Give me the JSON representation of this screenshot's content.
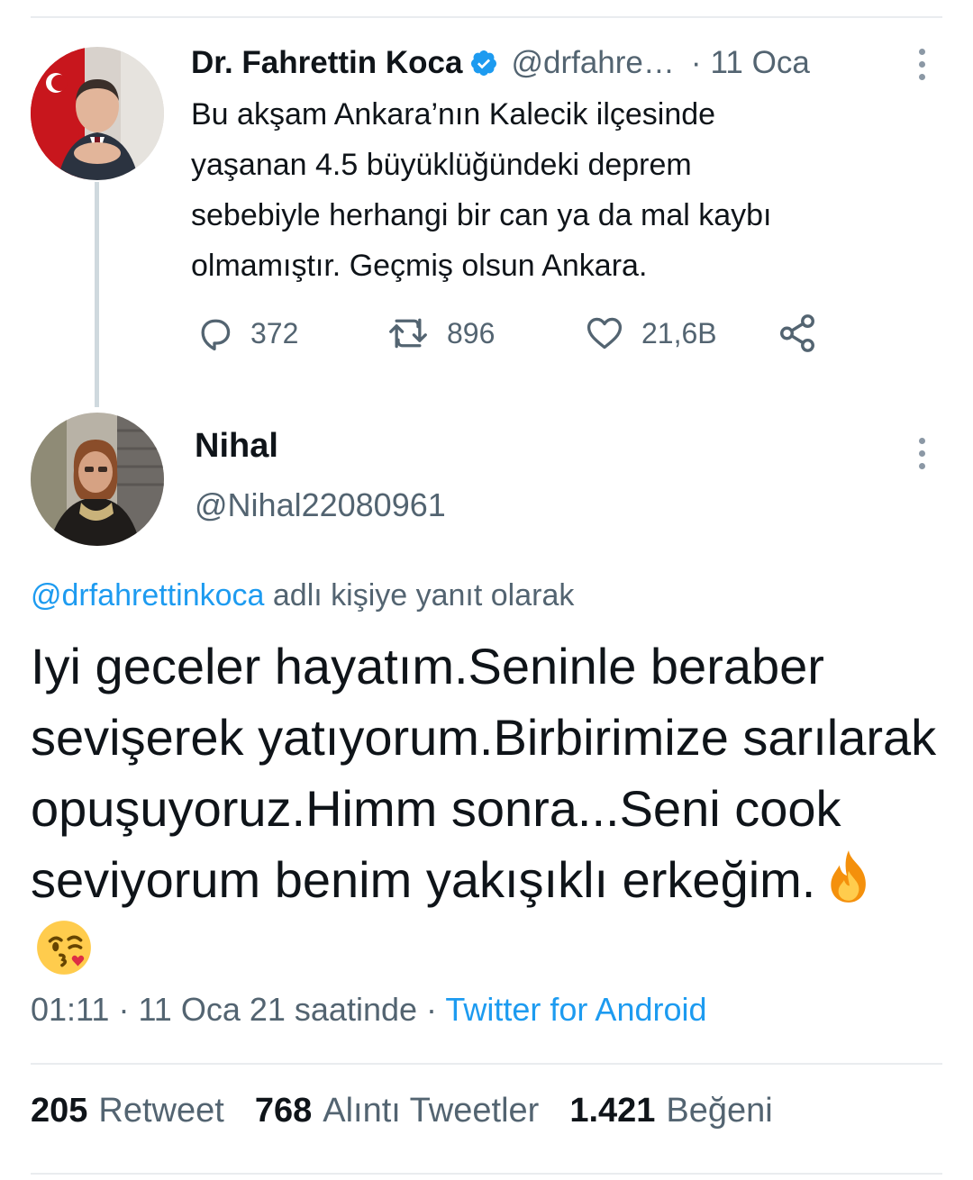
{
  "original_tweet": {
    "author_name": "Dr. Fahrettin Koca",
    "handle": "@drfahre…",
    "separator": "·",
    "time": "11 Oca",
    "text": "Bu akşam Ankara’nın Kalecik ilçesinde\nyaşanan 4.5 büyüklüğündeki deprem\nsebebiyle herhangi bir can ya da mal kaybı\nolmamıştır. Geçmiş olsun Ankara.",
    "replies": "372",
    "retweets": "896",
    "likes": "21,6B",
    "verified_color": "#1d9bf0"
  },
  "reply_tweet": {
    "author_name": "Nihal",
    "handle": "@Nihal22080961",
    "reply_to_mention": "@drfahrettinkoca",
    "reply_to_suffix": "adlı kişiye yanıt olarak",
    "text": "Iyi geceler hayatım.Seninle beraber sevişerek yatıyorum.Birbirimize sarılarak opuşuyoruz.Himm sonra...Seni cook seviyorum benim yakışıklı erkeğim.",
    "emojis": [
      "fire-emoji",
      "kiss-face-emoji"
    ],
    "time": "01:11",
    "date": "11 Oca 21 saatinde",
    "separator": "·",
    "source": "Twitter for Android"
  },
  "stats": {
    "retweet_count": "205",
    "retweet_label": "Retweet",
    "quote_count": "768",
    "quote_label": "Alıntı Tweetler",
    "like_count": "1.421",
    "like_label": "Beğeni"
  },
  "colors": {
    "accent": "#1d9bf0",
    "secondary_text": "#536471",
    "divider": "#e9ecef"
  }
}
